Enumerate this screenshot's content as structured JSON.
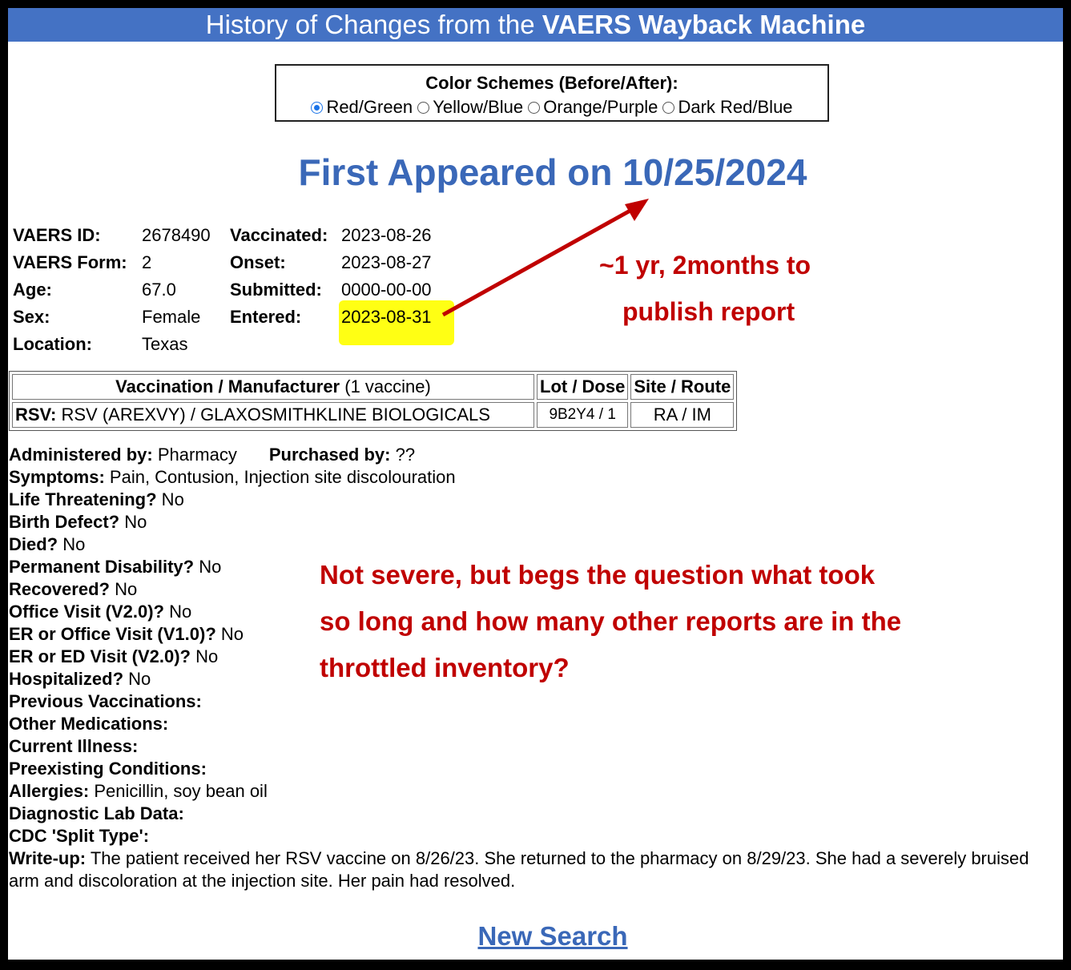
{
  "header": {
    "prefix": "History of Changes from the ",
    "brand": "VAERS Wayback Machine"
  },
  "color_schemes": {
    "title": "Color Schemes (Before/After):",
    "options": [
      "Red/Green",
      "Yellow/Blue",
      "Orange/Purple",
      "Dark Red/Blue"
    ],
    "selected": "Red/Green"
  },
  "first_appeared": "First Appeared on 10/25/2024",
  "record_left": [
    {
      "label": "VAERS ID:",
      "value": "2678490"
    },
    {
      "label": "VAERS Form:",
      "value": "2"
    },
    {
      "label": "Age:",
      "value": "67.0"
    },
    {
      "label": "Sex:",
      "value": "Female"
    },
    {
      "label": "Location:",
      "value": "Texas"
    }
  ],
  "record_right": [
    {
      "label": "Vaccinated:",
      "value": "2023-08-26"
    },
    {
      "label": "Onset:",
      "value": "2023-08-27"
    },
    {
      "label": "Submitted:",
      "value": "0000-00-00"
    },
    {
      "label": "Entered:",
      "value": "2023-08-31"
    }
  ],
  "vaccine_table": {
    "h1_bold": "Vaccination / Manufacturer",
    "h1_light": " (1 vaccine)",
    "h2": "Lot / Dose",
    "h3": "Site / Route",
    "row": {
      "code": "RSV:",
      "name": " RSV (AREXVY) / GLAXOSMITHKLINE BIOLOGICALS",
      "lot": "9B2Y4 / 1",
      "site": "RA / IM"
    }
  },
  "details": {
    "administered": {
      "label": "Administered by:",
      "value": " Pharmacy"
    },
    "purchased": {
      "label": "Purchased by:",
      "value": " ??"
    },
    "items": [
      {
        "label": "Symptoms:",
        "value": " Pain, Contusion, Injection site discolouration"
      },
      {
        "label": "Life Threatening?",
        "value": " No"
      },
      {
        "label": "Birth Defect?",
        "value": " No"
      },
      {
        "label": "Died?",
        "value": " No"
      },
      {
        "label": "Permanent Disability?",
        "value": " No"
      },
      {
        "label": "Recovered?",
        "value": " No"
      },
      {
        "label": "Office Visit (V2.0)?",
        "value": " No"
      },
      {
        "label": "ER or Office Visit (V1.0)?",
        "value": " No"
      },
      {
        "label": "ER or ED Visit (V2.0)?",
        "value": " No"
      },
      {
        "label": "Hospitalized?",
        "value": " No"
      },
      {
        "label": "Previous Vaccinations:",
        "value": ""
      },
      {
        "label": "Other Medications:",
        "value": ""
      },
      {
        "label": "Current Illness:",
        "value": ""
      },
      {
        "label": "Preexisting Conditions:",
        "value": ""
      },
      {
        "label": "Allergies:",
        "value": " Penicillin, soy bean oil"
      },
      {
        "label": "Diagnostic Lab Data:",
        "value": ""
      },
      {
        "label": "CDC 'Split Type':",
        "value": ""
      }
    ],
    "writeup": {
      "label": "Write-up:",
      "value": " The patient received her RSV vaccine on 8/26/23. She returned to the pharmacy on 8/29/23. She had a severely bruised arm and discoloration at the injection site. Her pain had resolved."
    }
  },
  "annotations": {
    "delay_line1": "~1 yr, 2months to",
    "delay_line2": "publish report",
    "note_line1": "Not severe, but begs the question what took",
    "note_line2": "so long and how many other reports are in the",
    "note_line3": "throttled inventory?"
  },
  "new_search": "New Search",
  "colors": {
    "header_bg": "#4472c4",
    "title_blue": "#3a68b8",
    "annotation_red": "#c00000",
    "highlight": "#ffff14"
  }
}
